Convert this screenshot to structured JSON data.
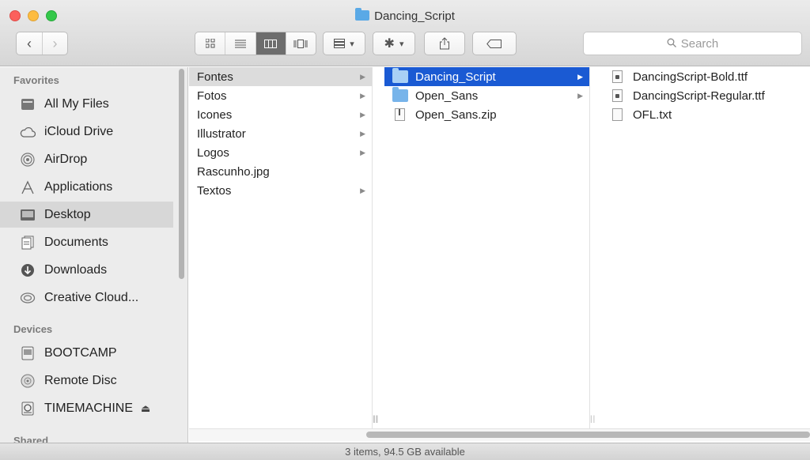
{
  "window": {
    "title": "Dancing_Script"
  },
  "toolbar": {
    "back_label": "‹",
    "forward_label": "›",
    "view_icons": [
      "icon-view-icon",
      "list-view-icon",
      "column-view-icon",
      "cover-flow-icon"
    ],
    "arrange_label": "▾",
    "action_label": "▾",
    "search_placeholder": "Search"
  },
  "sidebar": {
    "sections": [
      {
        "heading": "Favorites",
        "items": [
          {
            "label": "All My Files",
            "icon": "all-files-icon"
          },
          {
            "label": "iCloud Drive",
            "icon": "cloud-icon"
          },
          {
            "label": "AirDrop",
            "icon": "airdrop-icon"
          },
          {
            "label": "Applications",
            "icon": "applications-icon"
          },
          {
            "label": "Desktop",
            "icon": "desktop-icon",
            "selected": true
          },
          {
            "label": "Documents",
            "icon": "documents-icon"
          },
          {
            "label": "Downloads",
            "icon": "downloads-icon"
          },
          {
            "label": "Creative Cloud...",
            "icon": "creative-cloud-icon"
          }
        ]
      },
      {
        "heading": "Devices",
        "items": [
          {
            "label": "BOOTCAMP",
            "icon": "disk-icon"
          },
          {
            "label": "Remote Disc",
            "icon": "remote-disc-icon"
          },
          {
            "label": "TIMEMACHINE",
            "icon": "time-machine-icon",
            "eject": "⏏"
          }
        ]
      },
      {
        "heading": "Shared",
        "items": []
      }
    ]
  },
  "columns": [
    {
      "items": [
        {
          "label": "Fontes",
          "folder": true,
          "state": "selected-inactive"
        },
        {
          "label": "Fotos",
          "folder": true
        },
        {
          "label": "Icones",
          "folder": true
        },
        {
          "label": "Illustrator",
          "folder": true
        },
        {
          "label": "Logos",
          "folder": true
        },
        {
          "label": "Rascunho.jpg",
          "folder": false
        },
        {
          "label": "Textos",
          "folder": true
        }
      ]
    },
    {
      "items": [
        {
          "label": "Dancing_Script",
          "folder": true,
          "state": "selected-active"
        },
        {
          "label": "Open_Sans",
          "folder": true
        },
        {
          "label": "Open_Sans.zip",
          "folder": false,
          "kind": "zip"
        }
      ]
    },
    {
      "items": [
        {
          "label": "DancingScript-Bold.ttf",
          "kind": "font"
        },
        {
          "label": "DancingScript-Regular.ttf",
          "kind": "font"
        },
        {
          "label": "OFL.txt",
          "kind": "text"
        }
      ]
    }
  ],
  "status": {
    "text": "3 items, 94.5 GB available"
  }
}
